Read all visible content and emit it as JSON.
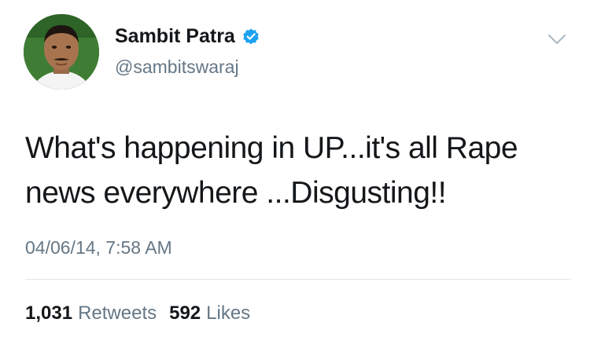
{
  "user": {
    "display_name": "Sambit Patra",
    "handle": "@sambitswaraj",
    "verified": true,
    "avatar_icon": "user-avatar-photo"
  },
  "tweet": {
    "text_lines": [
      "What's happening in UP...it's all Rape",
      "news everywhere ...Disgusting!!"
    ],
    "timestamp": "04/06/14, 7:58 AM"
  },
  "stats": {
    "retweets_count": "1,031",
    "retweets_label": "Retweets",
    "likes_count": "592",
    "likes_label": "Likes"
  },
  "icons": {
    "verified": "verified-badge-icon",
    "menu": "chevron-down-icon"
  },
  "colors": {
    "text_primary": "#14171a",
    "text_secondary": "#657786",
    "verified_blue": "#1da1f2",
    "divider": "#e1e8ed"
  }
}
